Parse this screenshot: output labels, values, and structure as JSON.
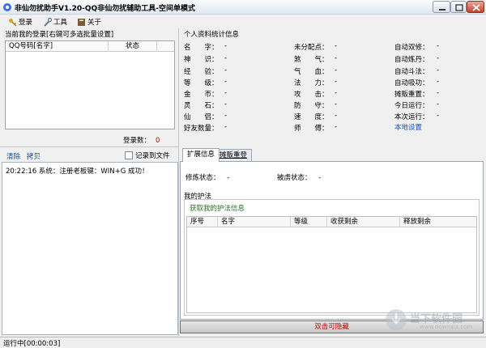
{
  "window": {
    "title": "非仙勿扰助手V1.20-QQ非仙勿扰辅助工具-空间单模式"
  },
  "menu": {
    "login": "登录",
    "tools": "工具",
    "about": "关于"
  },
  "left": {
    "header": "当前我的登录[右键可多选批量设置]",
    "columns": [
      "QQ号码[名字]",
      "状态"
    ],
    "login_count_label": "登录数：",
    "login_count": "0",
    "clear": "清除",
    "copy": "拷贝",
    "log_to_file": "记录到文件",
    "log": [
      "20:22:16 系统：注册老板键：WIN+G 成功！"
    ]
  },
  "stats": {
    "header": "个人资料统计信息",
    "col1": [
      {
        "label": "名　　字：",
        "value": "-"
      },
      {
        "label": "神　　识：",
        "value": "-"
      },
      {
        "label": "经　　验：",
        "value": "-"
      },
      {
        "label": "等　　级：",
        "value": "-"
      },
      {
        "label": "金　　币：",
        "value": "-"
      },
      {
        "label": "灵　　石：",
        "value": "-"
      },
      {
        "label": "仙　　侣：",
        "value": "-"
      },
      {
        "label": "好友数量：",
        "value": "-"
      }
    ],
    "col2": [
      {
        "label": "未分配点：",
        "value": "-"
      },
      {
        "label": "煞　　气：",
        "value": "-"
      },
      {
        "label": "气　　血：",
        "value": "-"
      },
      {
        "label": "法　　力：",
        "value": "-"
      },
      {
        "label": "攻　　击：",
        "value": "-"
      },
      {
        "label": "防　　守：",
        "value": "-"
      },
      {
        "label": "速　　度：",
        "value": "-"
      },
      {
        "label": "师　　傅：",
        "value": "-"
      }
    ],
    "col3": [
      {
        "label": "自动双修：",
        "value": "-"
      },
      {
        "label": "自动炼丹：",
        "value": "-"
      },
      {
        "label": "自动斗法：",
        "value": "-"
      },
      {
        "label": "自动吸功：",
        "value": "-"
      },
      {
        "label": "摊贩重置：",
        "value": "-"
      },
      {
        "label": "今日运行：",
        "value": "-"
      },
      {
        "label": "本次运行：",
        "value": "-"
      }
    ],
    "local_settings": "本地设置"
  },
  "tabs": {
    "ext": "扩展信息",
    "link": "摊贩重登"
  },
  "ext": {
    "cultivation_label": "修炼状态：",
    "cultivation_value": "-",
    "captured_label": "被虏状态：",
    "captured_value": "-",
    "protect_label": "我的护法",
    "protect_link": "获取我的护法信息",
    "columns": [
      "序号",
      "名字",
      "等级",
      "收获剩余",
      "释放剩余"
    ]
  },
  "hide_button": "双击可隐藏",
  "status": "运行中[00:00:03]",
  "watermark": {
    "text": "当下软件园",
    "url": "www.downxia.com"
  }
}
